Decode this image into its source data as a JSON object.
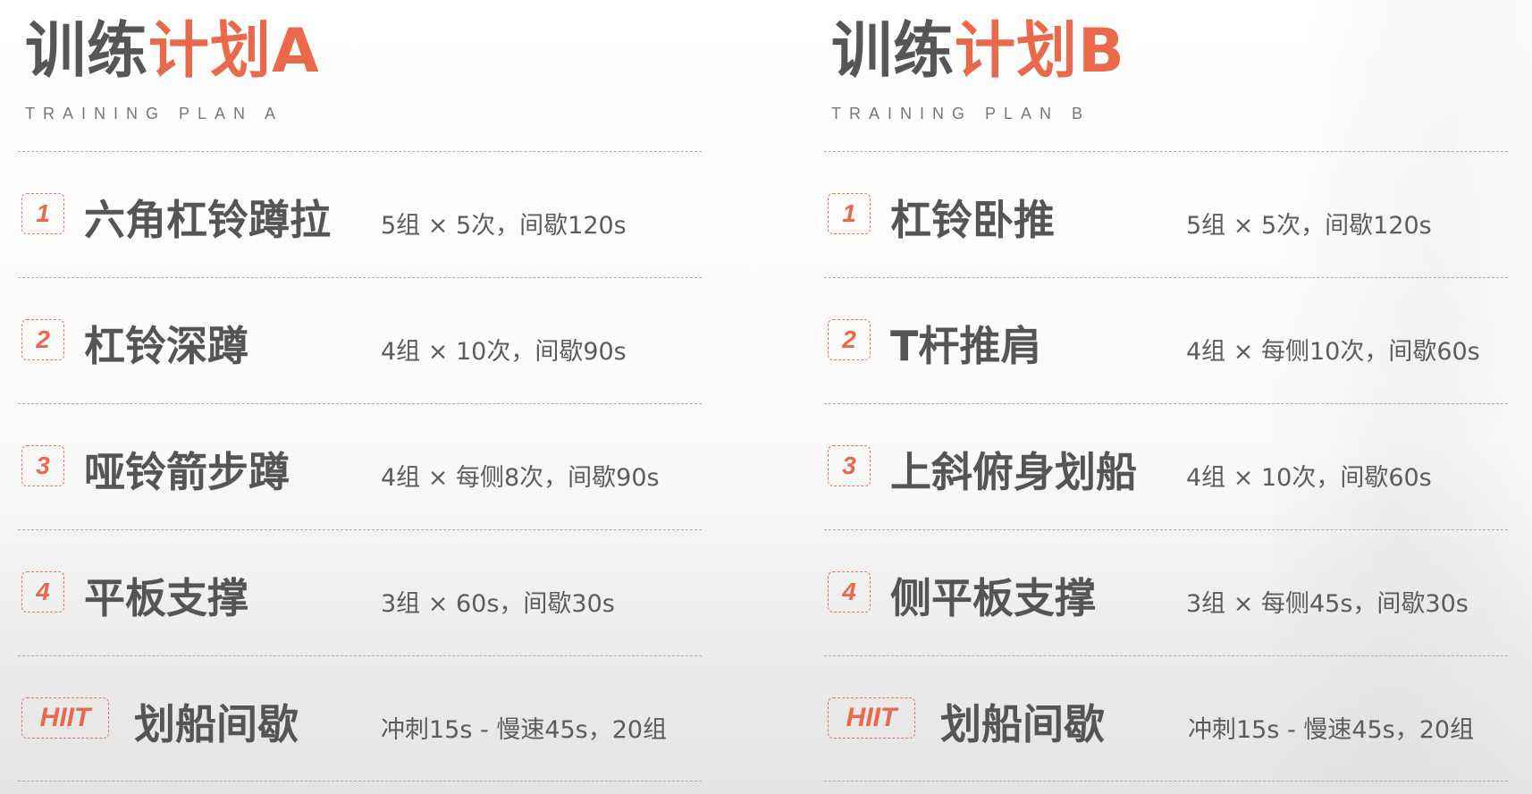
{
  "colors": {
    "accent": "#e9694a",
    "text": "#555555",
    "divider": "#aaaaaa"
  },
  "plans": [
    {
      "title_dark": "训练",
      "title_accent": "计划A",
      "subtitle": "TRAINING PLAN A",
      "rows": [
        {
          "badge": "1",
          "name": "六角杠铃蹲拉",
          "detail": "5组 × 5次，间歇120s"
        },
        {
          "badge": "2",
          "name": "杠铃深蹲",
          "detail": "4组 × 10次，间歇90s"
        },
        {
          "badge": "3",
          "name": "哑铃箭步蹲",
          "detail": "4组 × 每侧8次，间歇90s"
        },
        {
          "badge": "4",
          "name": "平板支撑",
          "detail": "3组 × 60s，间歇30s"
        },
        {
          "badge": "HIIT",
          "name": "划船间歇",
          "detail": "冲刺15s - 慢速45s，20组"
        }
      ]
    },
    {
      "title_dark": "训练",
      "title_accent": "计划B",
      "subtitle": "TRAINING PLAN B",
      "rows": [
        {
          "badge": "1",
          "name": "杠铃卧推",
          "detail": "5组 × 5次，间歇120s"
        },
        {
          "badge": "2",
          "name": "T杆推肩",
          "detail": "4组 × 每侧10次，间歇60s"
        },
        {
          "badge": "3",
          "name": "上斜俯身划船",
          "detail": "4组 × 10次，间歇60s"
        },
        {
          "badge": "4",
          "name": "侧平板支撑",
          "detail": "3组 × 每侧45s，间歇30s"
        },
        {
          "badge": "HIIT",
          "name": "划船间歇",
          "detail": "冲刺15s - 慢速45s，20组"
        }
      ]
    }
  ]
}
